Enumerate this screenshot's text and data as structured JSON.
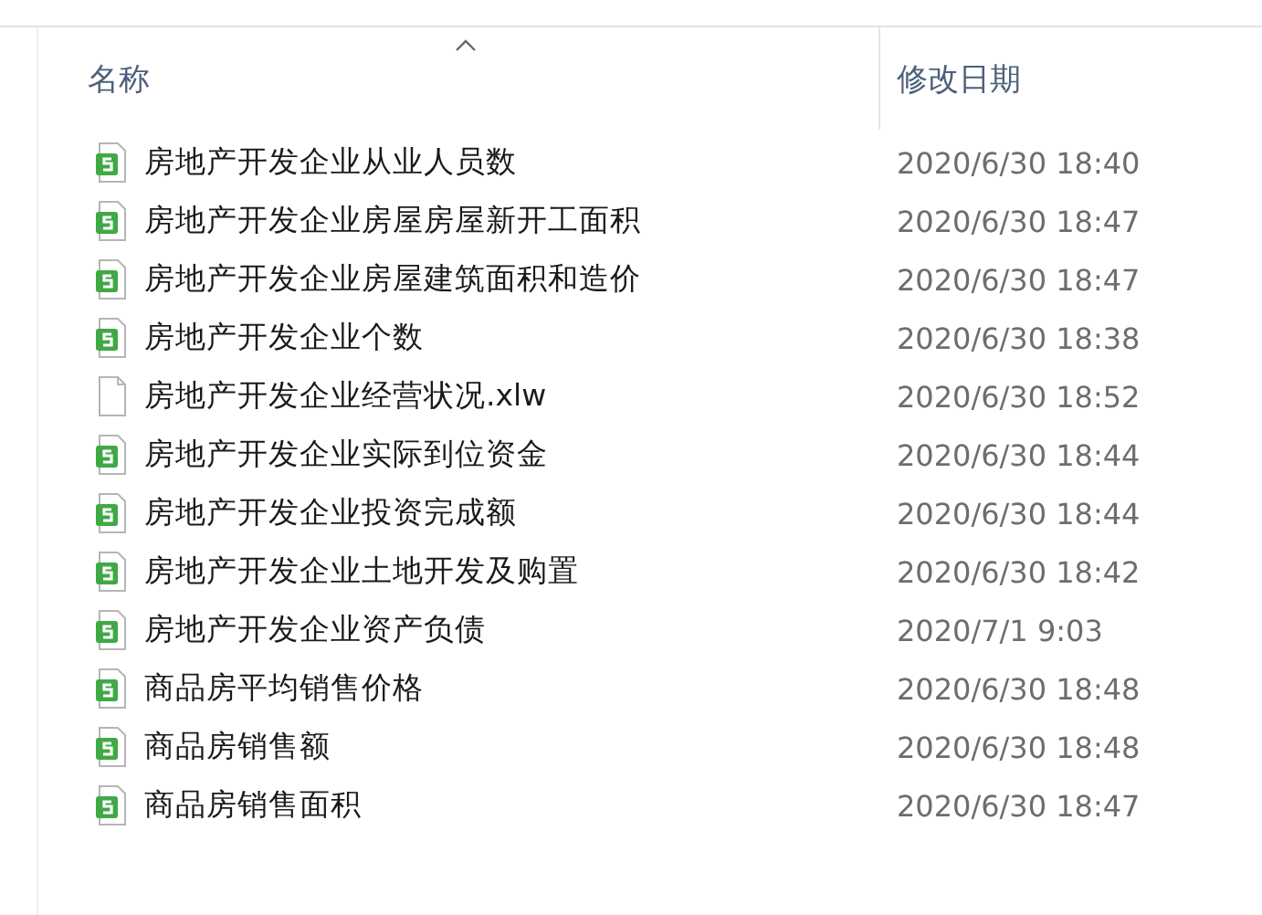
{
  "header": {
    "columns": [
      {
        "label": "名称",
        "sorted": true
      },
      {
        "label": "修改日期",
        "sorted": false
      }
    ]
  },
  "files": [
    {
      "name": "房地产开发企业从业人员数",
      "modified": "2020/6/30 18:40",
      "kind": "sheet"
    },
    {
      "name": "房地产开发企业房屋房屋新开工面积",
      "modified": "2020/6/30 18:47",
      "kind": "sheet"
    },
    {
      "name": "房地产开发企业房屋建筑面积和造价",
      "modified": "2020/6/30 18:47",
      "kind": "sheet"
    },
    {
      "name": "房地产开发企业个数",
      "modified": "2020/6/30 18:38",
      "kind": "sheet"
    },
    {
      "name": "房地产开发企业经营状况.xlw",
      "modified": "2020/6/30 18:52",
      "kind": "blank"
    },
    {
      "name": "房地产开发企业实际到位资金",
      "modified": "2020/6/30 18:44",
      "kind": "sheet"
    },
    {
      "name": "房地产开发企业投资完成额",
      "modified": "2020/6/30 18:44",
      "kind": "sheet"
    },
    {
      "name": "房地产开发企业土地开发及购置",
      "modified": "2020/6/30 18:42",
      "kind": "sheet"
    },
    {
      "name": "房地产开发企业资产负债",
      "modified": "2020/7/1 9:03",
      "kind": "sheet"
    },
    {
      "name": "商品房平均销售价格",
      "modified": "2020/6/30 18:48",
      "kind": "sheet"
    },
    {
      "name": "商品房销售额",
      "modified": "2020/6/30 18:48",
      "kind": "sheet"
    },
    {
      "name": "商品房销售面积",
      "modified": "2020/6/30 18:47",
      "kind": "sheet"
    }
  ]
}
